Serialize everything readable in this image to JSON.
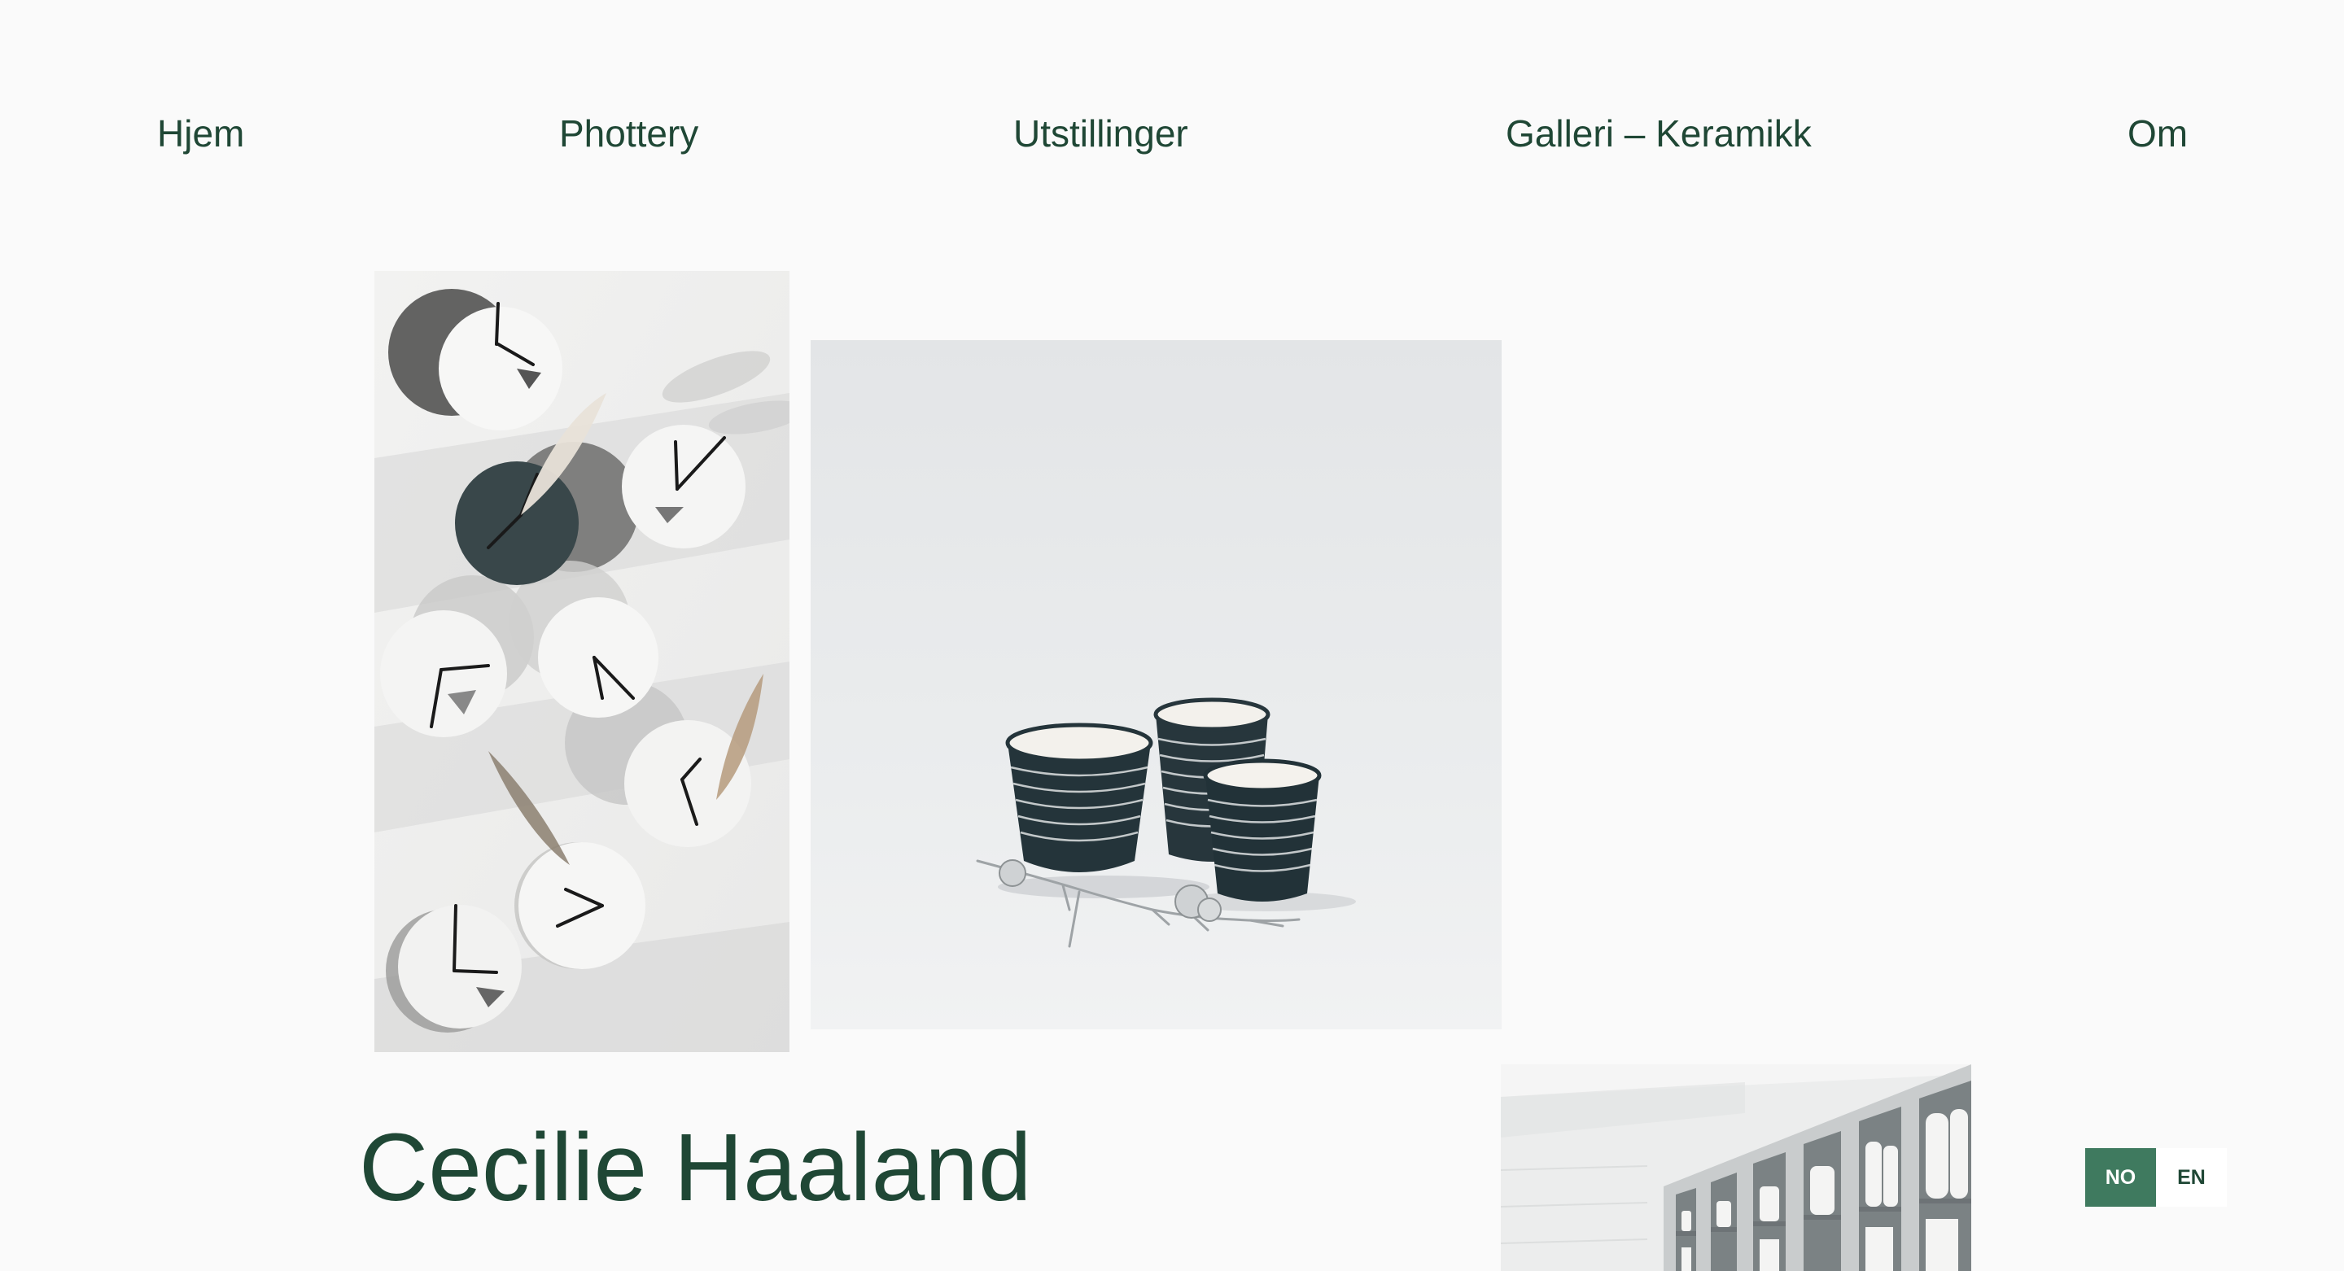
{
  "nav": {
    "items": [
      {
        "label": "Hjem"
      },
      {
        "label": "Phottery"
      },
      {
        "label": "Utstillinger"
      },
      {
        "label": "Galleri – Keramikk"
      },
      {
        "label": "Om"
      }
    ]
  },
  "hero": {
    "name": "Cecilie Haaland"
  },
  "language": {
    "options": [
      "NO",
      "EN"
    ],
    "selected": "NO"
  },
  "colors": {
    "text": "#1f4735",
    "active_language": "#3f7a5f",
    "background": "#fafafa"
  },
  "images": [
    {
      "subject": "ceramic wall clocks with feathers"
    },
    {
      "subject": "three striped ceramic cups with pine cones"
    },
    {
      "subject": "white ceramics on shelves"
    }
  ]
}
